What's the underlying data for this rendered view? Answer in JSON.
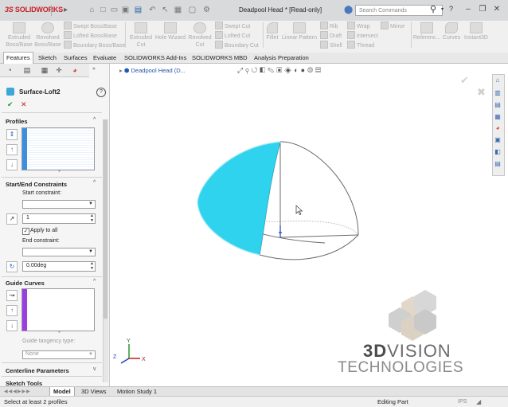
{
  "app": {
    "brand": "SOLIDWORKS",
    "brand_prefix": "3S",
    "document_title": "Deadpool Head * [Read-only]",
    "search_placeholder": "Search Commands",
    "window_buttons": [
      "–",
      "❐",
      "✕"
    ]
  },
  "commands": {
    "extruded_boss": "Extruded\nBoss/Base",
    "revolved_boss": "Revolved\nBoss/Base",
    "swept_boss": "Swept Boss/Base",
    "lofted_boss": "Lofted Boss/Base",
    "boundary_boss": "Boundary Boss/Base",
    "extruded_cut": "Extruded\nCut",
    "hole_wizard": "Hole Wizard",
    "revolved_cut": "Revolved\nCut",
    "swept_cut": "Swept Cut",
    "lofted_cut": "Lofted Cut",
    "boundary_cut": "Boundary Cut",
    "fillet": "Fillet",
    "linear_pattern": "Linear Pattern",
    "rib": "Rib",
    "draft": "Draft",
    "shell": "Shell",
    "wrap": "Wrap",
    "intersect": "Intersect",
    "thread": "Thread",
    "mirror": "Mirror",
    "reference": "Referenc...",
    "curves": "Curves",
    "instant3d": "Instant3D"
  },
  "tabs": [
    "Features",
    "Sketch",
    "Surfaces",
    "Evaluate",
    "SOLIDWORKS Add-Ins",
    "SOLIDWORKS MBD",
    "Analysis Preparation"
  ],
  "feature_panel": {
    "title": "Surface-Loft2",
    "help": "?",
    "ok": "✔",
    "cancel": "✕",
    "profiles_label": "Profiles",
    "start_end_label": "Start/End Constraints",
    "start_constraint_label": "Start constraint:",
    "start_value": "1",
    "apply_to_all": "Apply to all",
    "end_constraint_label": "End constraint:",
    "end_value": "0.00deg",
    "guide_curves_label": "Guide Curves",
    "guide_tangency_label": "Guide tangency type:",
    "guide_tangency_value": "None",
    "centerline_label": "Centerline Parameters",
    "sketch_tools_label": "Sketch Tools"
  },
  "viewport": {
    "tree_item": "Deadpool Head (D...",
    "triad_x": "X",
    "triad_y": "Y",
    "triad_z": "Z",
    "watermark_line1_a": "3D",
    "watermark_line1_b": "VISION",
    "watermark_line2": "TECHNOLOGIES",
    "surface_color": "#2fd3ee"
  },
  "bottom_tabs": [
    "Model",
    "3D Views",
    "Motion Study 1"
  ],
  "status": {
    "left": "Select at least 2 profiles",
    "right": "Editing Part",
    "units": "IPS"
  }
}
